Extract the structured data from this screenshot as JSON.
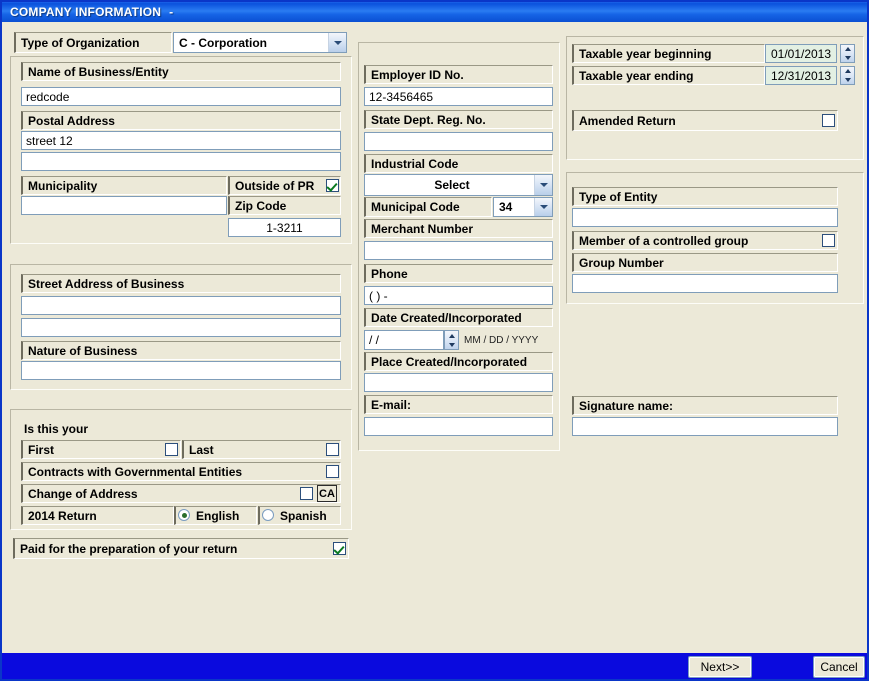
{
  "window": {
    "title": "COMPANY INFORMATION",
    "title_suffix": "-",
    "title_bar_color": "#0A51DD",
    "body_color": "#ECE9D8",
    "border_color": "#0A36C8",
    "bottom_bar_color": "#0A0ADE"
  },
  "org": {
    "label": "Type of Organization",
    "value": "C - Corporation"
  },
  "left": {
    "name_label": "Name of Business/Entity",
    "name_value": "redcode",
    "postal_label": "Postal Address",
    "postal_line1": "street 12",
    "postal_line2": "",
    "municipality_label": "Municipality",
    "municipality_value": "",
    "outside_pr_label": "Outside of PR",
    "outside_pr_checked": true,
    "zip_label": "Zip Code",
    "zip_value": "1-3211",
    "street_label": "Street Address of Business",
    "street_line1": "",
    "street_line2": "",
    "nature_label": "Nature of Business",
    "nature_value": "",
    "is_this_your_label": "Is this your",
    "first_label": "First",
    "first_checked": false,
    "last_label": "Last",
    "last_checked": false,
    "contracts_label": "Contracts with Governmental Entities",
    "contracts_checked": false,
    "change_address_label": "Change of Address",
    "change_address_checked": false,
    "ca_button_label": "CA",
    "return_year_label": "2014 Return",
    "english_label": "English",
    "spanish_label": "Spanish",
    "language_selected": "English",
    "paid_label": "Paid for the preparation of your return",
    "paid_checked": true
  },
  "middle": {
    "employer_id_label": "Employer ID No.",
    "employer_id_value": "12-3456465",
    "state_dept_label": "State Dept. Reg. No.",
    "state_dept_value": "",
    "industrial_code_label": "Industrial Code",
    "industrial_code_value": "Select",
    "municipal_code_label": "Municipal Code",
    "municipal_code_value": "34",
    "merchant_label": "Merchant Number",
    "merchant_value": "",
    "phone_label": "Phone",
    "phone_value": "(   )    -",
    "date_created_label": "Date Created/Incorporated",
    "date_created_value": "  /   /",
    "date_created_hint": "MM / DD / YYYY",
    "place_created_label": "Place Created/Incorporated",
    "place_created_value": "",
    "email_label": "E-mail:",
    "email_value": ""
  },
  "right": {
    "year_begin_label": "Taxable year beginning",
    "year_begin_value": "01/01/2013",
    "year_end_label": "Taxable year ending",
    "year_end_value": "12/31/2013",
    "amended_label": "Amended Return",
    "amended_checked": false,
    "entity_type_label": "Type of Entity",
    "entity_type_value": "",
    "controlled_group_label": "Member of a controlled group",
    "controlled_group_checked": false,
    "group_number_label": "Group Number",
    "group_number_value": "",
    "signature_label": "Signature name:",
    "signature_value": ""
  },
  "footer": {
    "next_label": "Next>>",
    "cancel_label": "Cancel"
  }
}
